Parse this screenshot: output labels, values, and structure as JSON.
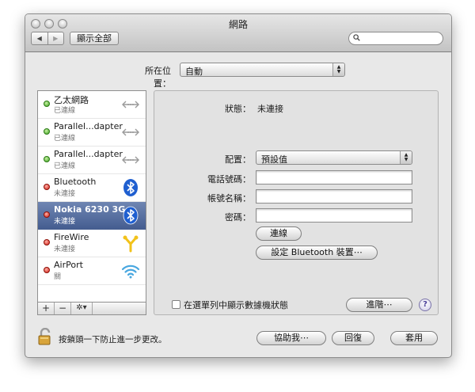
{
  "window": {
    "title": "網路",
    "nav_back": "◀",
    "nav_forward": "▶",
    "show_all_label": "顯示全部",
    "search_placeholder": ""
  },
  "location": {
    "label": "所在位置：",
    "value": "自動"
  },
  "services": [
    {
      "name": "乙太網路",
      "status": "已連線",
      "status_color": "green",
      "icon": "ethernet-icon"
    },
    {
      "name": "Parallel...dapter",
      "status": "已連線",
      "status_color": "green",
      "icon": "ethernet-icon"
    },
    {
      "name": "Parallel...dapter",
      "status": "已連線",
      "status_color": "green",
      "icon": "ethernet-icon"
    },
    {
      "name": "Bluetooth",
      "status": "未連接",
      "status_color": "red",
      "icon": "bluetooth-icon"
    },
    {
      "name": "Nokia 6230 3G",
      "status": "未連接",
      "status_color": "red",
      "icon": "bluetooth-icon",
      "selected": true
    },
    {
      "name": "FireWire",
      "status": "未連接",
      "status_color": "red",
      "icon": "firewire-icon"
    },
    {
      "name": "AirPort",
      "status": "關",
      "status_color": "red",
      "icon": "airport-icon"
    }
  ],
  "list_toolbar": {
    "add": "+",
    "remove": "−",
    "gear": "✲▾"
  },
  "detail": {
    "status_label": "狀態：",
    "status_value": "未連接",
    "config_label": "配置：",
    "config_value": "預設值",
    "phone_label": "電話號碼：",
    "phone_value": "",
    "account_label": "帳號名稱：",
    "account_value": "",
    "password_label": "密碼：",
    "password_value": "",
    "connect_button": "連線",
    "bt_setup_button": "設定 Bluetooth 裝置⋯",
    "show_modem_status_label": "在選單列中顯示數據機狀態",
    "show_modem_status_checked": false,
    "advanced_button": "進階⋯",
    "help_button": "?"
  },
  "footer": {
    "lock_text": "按鎖頭一下防止進一步更改。",
    "assist_button": "協助我⋯",
    "revert_button": "回復",
    "apply_button": "套用"
  },
  "colors": {
    "selection": "#4f6799",
    "status_green": "#3aa11c",
    "status_red": "#d11d12",
    "bluetooth_blue": "#1f5fd0",
    "firewire_yellow": "#f2c21a"
  }
}
